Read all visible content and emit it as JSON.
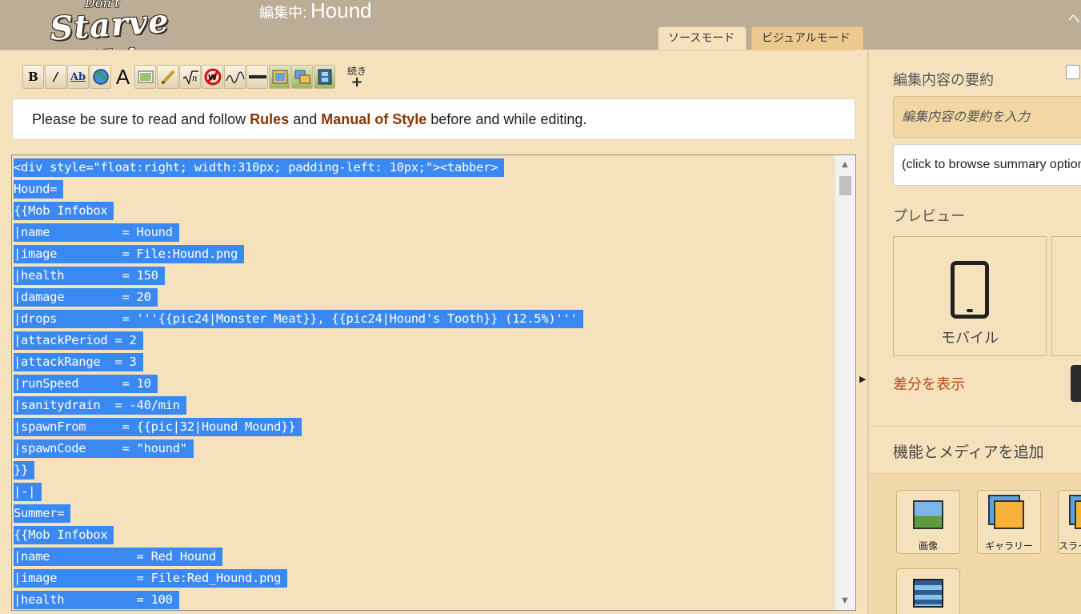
{
  "header": {
    "logo_small": "Don't",
    "logo_big": "Starve Wiki",
    "edit_prefix": "編集中: ",
    "page_name": "Hound",
    "right_text": "へ八"
  },
  "mode_tabs": {
    "source": "ソースモード",
    "visual": "ビジュアルモード"
  },
  "toolbar": {
    "bold": "B",
    "italic": "I",
    "internal_link": "Ab",
    "external_link_icon": "globe-icon",
    "font": "A",
    "more_label": "続き",
    "more_plus": "+"
  },
  "notice": {
    "before": "Please be sure to read and follow ",
    "rules": "Rules",
    "and": " and ",
    "manual": "Manual of Style",
    "after": " before and while editing."
  },
  "code_lines": [
    "<div style=\"float:right; width:310px; padding-left: 10px;\"><tabber>",
    "Hound=",
    "{{Mob Infobox",
    "|name          = Hound",
    "|image         = File:Hound.png",
    "|health        = 150",
    "|damage        = 20",
    "|drops         = '''{{pic24|Monster Meat}}, {{pic24|Hound's Tooth}} (12.5%)'''",
    "|attackPeriod = 2",
    "|attackRange  = 3",
    "|runSpeed      = 10",
    "|sanitydrain  = -40/min",
    "|spawnFrom     = {{pic|32|Hound Mound}}",
    "|spawnCode     = \"hound\"",
    "}}",
    "|-|",
    "Summer=",
    "{{Mob Infobox",
    "|name            = Red Hound",
    "|image           = File:Red_Hound.png",
    "|health          = 100"
  ],
  "rail": {
    "summary_label": "編集内容の要約",
    "summary_placeholder": "編集内容の要約を入力",
    "summary_browse": "(click to browse summary options)",
    "preview_label": "プレビュー",
    "mobile_label": "モバイル",
    "diff_link": "差分を表示",
    "features_label": "機能とメディアを追加",
    "features": {
      "image": "画像",
      "gallery": "ギャラリー",
      "slideshow": "スライドショー"
    }
  },
  "colors": {
    "selection": "#3a88f2",
    "background": "#f5e2bd",
    "link": "#8a3606"
  }
}
